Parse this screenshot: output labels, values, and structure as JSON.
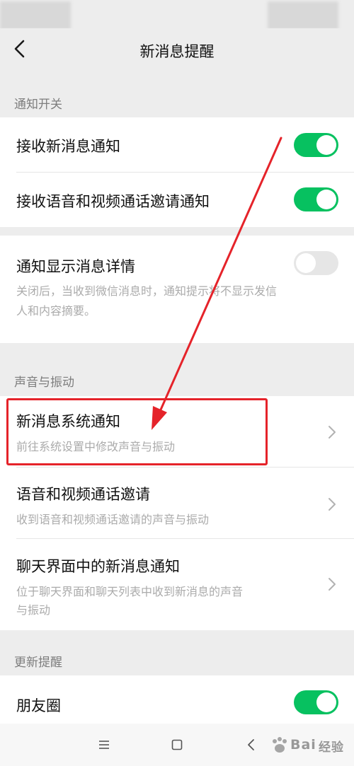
{
  "header": {
    "title": "新消息提醒",
    "back_icon": "chevron-left-icon"
  },
  "sections": {
    "notify_switch": {
      "label": "通知开关",
      "items": [
        {
          "title": "接收新消息通知",
          "toggle": "on"
        },
        {
          "title": "接收语音和视频通话邀请通知",
          "toggle": "on"
        }
      ]
    },
    "detail": {
      "title": "通知显示消息详情",
      "toggle": "off",
      "desc_line1": "关闭后，当收到微信消息时，通知提示将不显示发信",
      "desc_line2": "人和内容摘要。"
    },
    "sound": {
      "label": "声音与振动",
      "items": [
        {
          "title": "新消息系统通知",
          "desc": "前往系统设置中修改声音与振动"
        },
        {
          "title": "语音和视频通话邀请",
          "desc": "收到语音和视频通话邀请的声音与振动"
        },
        {
          "title": "聊天界面中的新消息通知",
          "desc_line1": "位于聊天界面和聊天列表中收到新消息的声音",
          "desc_line2": "与振动"
        }
      ]
    },
    "update": {
      "label": "更新提醒",
      "items": [
        {
          "title": "朋友圈",
          "toggle": "on"
        }
      ]
    }
  },
  "system_nav": {
    "menu_icon": "menu-icon",
    "home_icon": "home-square-icon",
    "back_icon": "back-triangle-icon"
  },
  "watermark": {
    "logo_text": "Bai",
    "logo_text2": "经验"
  },
  "colors": {
    "toggle_on": "#07c160",
    "toggle_off": "#e6e6e6",
    "annotation_red": "#e5232a",
    "background": "#ededed"
  }
}
